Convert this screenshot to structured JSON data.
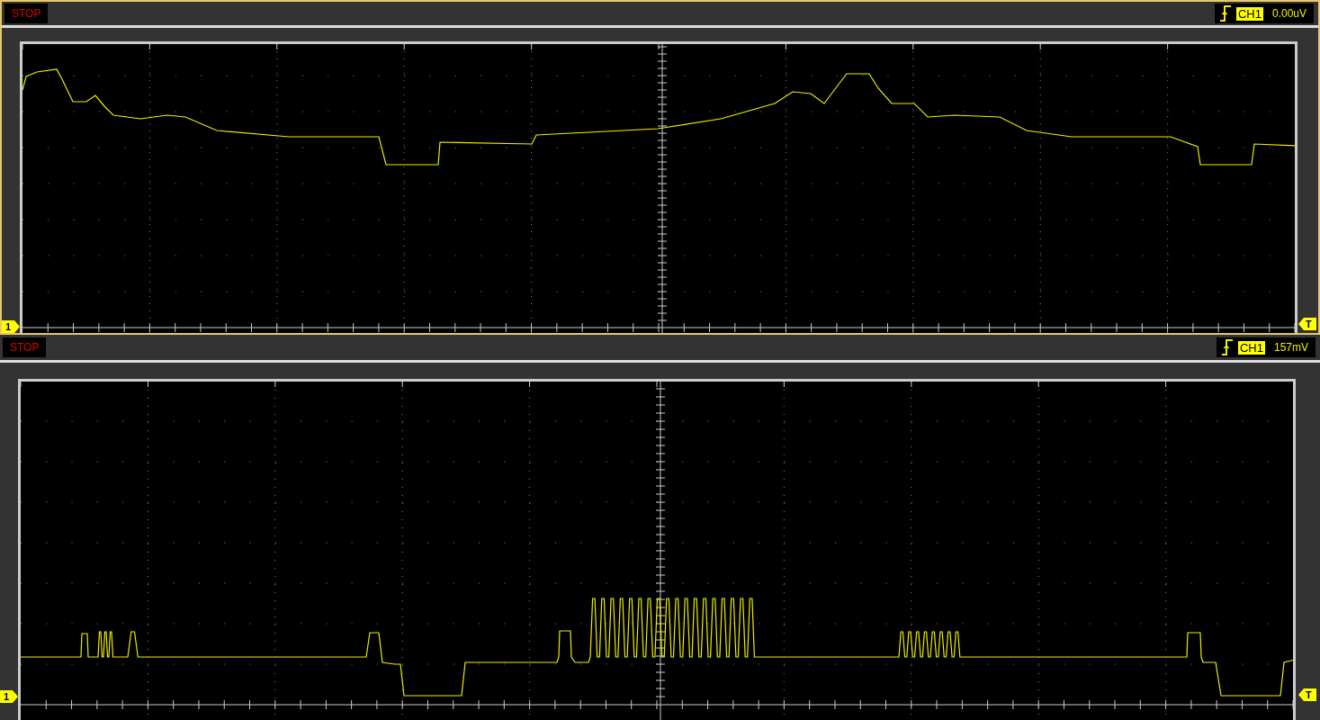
{
  "panels": [
    {
      "status": "STOP",
      "trigger": {
        "channel": "CH1",
        "level": "0.00uV"
      },
      "channel_marker": "1",
      "trigger_marker": "T"
    },
    {
      "status": "STOP",
      "trigger": {
        "channel": "CH1",
        "level": "157mV"
      },
      "channel_marker": "1",
      "trigger_marker": "T"
    }
  ]
}
